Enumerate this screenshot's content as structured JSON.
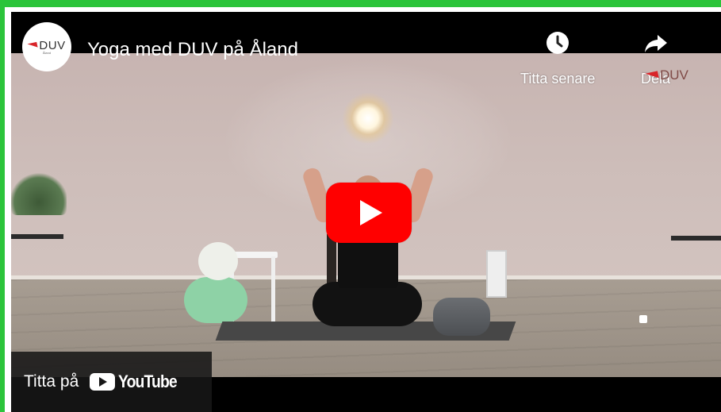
{
  "video": {
    "title": "Yoga med DUV på Åland"
  },
  "channel": {
    "avatar_text": "DUV",
    "avatar_subtext": "Åland",
    "watermark_text": "DUV"
  },
  "actions": {
    "watch_later_label": "Titta senare",
    "share_label": "Dela"
  },
  "watch_on": {
    "prefix": "Titta på",
    "brand": "YouTube"
  },
  "colors": {
    "frame_border": "#2bc43a",
    "play_button": "#ff0000",
    "brand_red": "#d8252a"
  },
  "icons": {
    "watch_later": "clock-icon",
    "share": "share-arrow-icon",
    "play": "play-icon",
    "youtube": "youtube-logo-icon"
  }
}
